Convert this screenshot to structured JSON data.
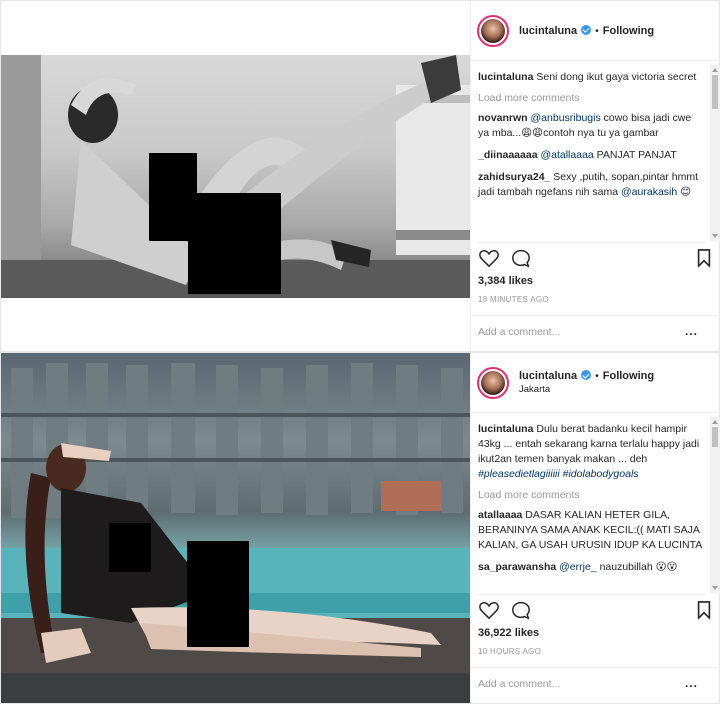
{
  "posts": [
    {
      "username": "lucintaluna",
      "follow_status": "Following",
      "location": "",
      "caption_user": "lucintaluna",
      "caption": "Seni dong ikut gaya victoria secret",
      "load_more": "Load more comments",
      "comments": [
        {
          "user": "novanrwn",
          "mention": "@anbusribugis",
          "text": " cowo bisa jadi cwe ya mba...😩😩contoh nya tu ya gambar"
        },
        {
          "user": "_diinaaaaaa",
          "mention": "@atallaaaa",
          "text": " PANJAT PANJAT"
        },
        {
          "user": "zahidsurya24_",
          "mention": "",
          "text": " Sexy ,putih, sopan,pintar hmmt jadi tambah ngefans nih sama ",
          "mention2": "@aurakasih",
          "tail": " 😊"
        }
      ],
      "likes": "3,384 likes",
      "time": "18 MINUTES AGO",
      "add_comment_placeholder": "Add a comment...",
      "more_options": "..."
    },
    {
      "username": "lucintaluna",
      "follow_status": "Following",
      "location": "Jakarta",
      "caption_user": "lucintaluna",
      "caption": "Dulu berat badanku kecil hampir 43kg ... entah sekarang karna terlalu happy jadi ikut2an temen banyak makan ... deh ",
      "caption_tags": "#pleasedietlagiiiiii #idolabodygoals",
      "load_more": "Load more comments",
      "comments": [
        {
          "user": "atallaaaa",
          "mention": "",
          "text": " DASAR KALIAN HETER GILA, BERANINYA SAMA ANAK KECIL:(( MATI SAJA KALIAN, GA USAH URUSIN IDUP KA LUCINTA"
        },
        {
          "user": "sa_parawansha",
          "mention": "@errje_",
          "text": " nauzubillah 😮😮"
        }
      ],
      "likes": "36,922 likes",
      "time": "10 HOURS AGO",
      "add_comment_placeholder": "Add a comment...",
      "more_options": "..."
    }
  ],
  "icons": [
    "heart-icon",
    "comment-icon",
    "bookmark-icon",
    "verified-icon",
    "more-icon"
  ],
  "colors": {
    "verified": "#3897f0",
    "mention": "#003569",
    "muted": "#999999"
  }
}
